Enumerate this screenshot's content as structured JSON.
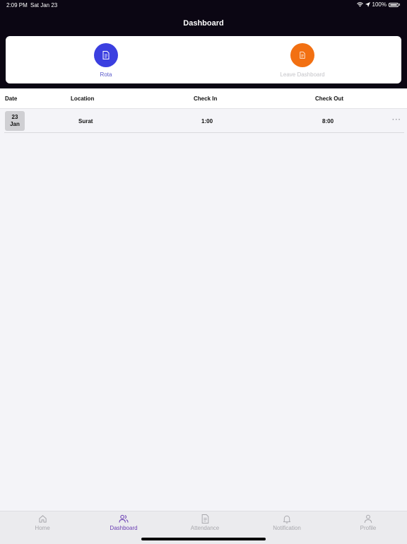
{
  "status_bar": {
    "time": "2:09 PM",
    "date": "Sat Jan 23",
    "battery": "100%"
  },
  "header": {
    "title": "Dashboard"
  },
  "actions": [
    {
      "label": "Rota",
      "icon": "document-icon",
      "color": "#3b3fe0",
      "label_color": "#5a5acb"
    },
    {
      "label": "Leave Dashboard",
      "icon": "document-icon",
      "color": "#f27012",
      "label_color": "#c4c4c8"
    }
  ],
  "table": {
    "columns": [
      "Date",
      "Location",
      "Check In",
      "Check Out"
    ],
    "rows": [
      {
        "day": "23",
        "month": "Jan",
        "location": "Surat",
        "check_in": "1:00",
        "check_out": "8:00",
        "more": "···"
      }
    ]
  },
  "tabbar": {
    "tabs": [
      {
        "label": "Home",
        "icon": "home-icon"
      },
      {
        "label": "Dashboard",
        "icon": "users-icon",
        "active": true
      },
      {
        "label": "Attendance",
        "icon": "document-icon"
      },
      {
        "label": "Notification",
        "icon": "bell-icon"
      },
      {
        "label": "Profile",
        "icon": "person-icon"
      }
    ]
  }
}
